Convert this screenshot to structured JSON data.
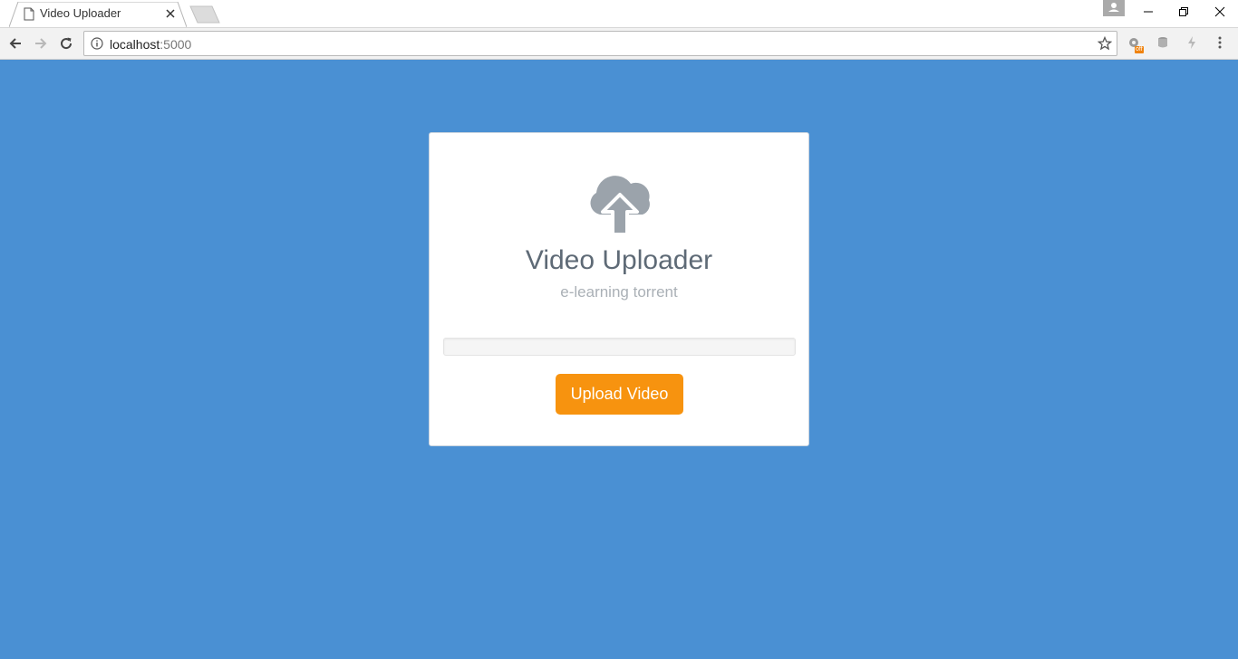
{
  "browser": {
    "tab": {
      "title": "Video Uploader",
      "icon": "page-icon"
    },
    "address_bar": {
      "host": "localhost",
      "port": ":5000"
    },
    "extensions": {
      "badge": "off"
    }
  },
  "page": {
    "background_color": "#4a90d3",
    "card": {
      "icon": "cloud-upload-icon",
      "title": "Video Uploader",
      "subtitle": "e-learning torrent",
      "progress": 0,
      "button_label": "Upload Video",
      "accent_color": "#f7930f"
    }
  }
}
